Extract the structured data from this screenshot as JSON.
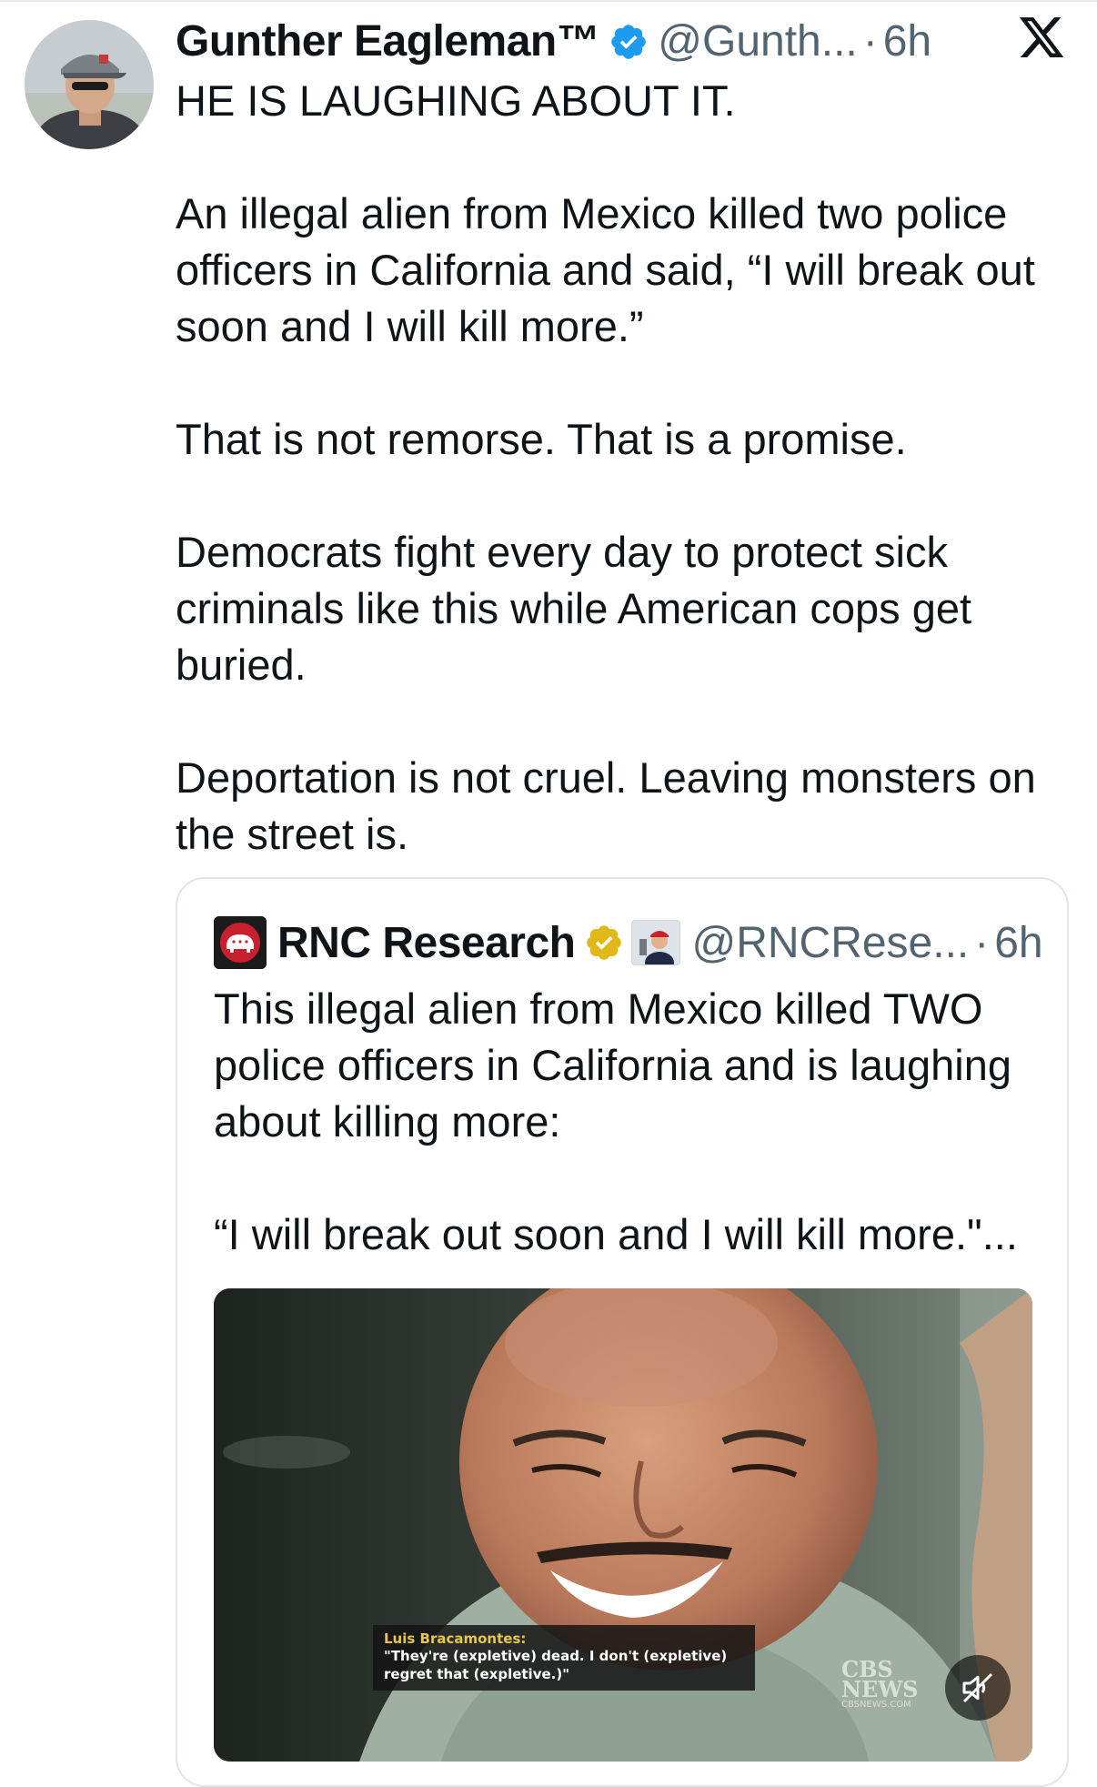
{
  "tweet": {
    "author_name": "Gunther Eagleman™",
    "handle": "@Gunth...",
    "separator": "·",
    "time": "6h",
    "paragraphs": [
      "HE IS LAUGHING ABOUT IT.",
      "An illegal alien from Mexico killed two police officers in California and said, “I will break out soon and I will kill more.”",
      "That is not remorse. That is a promise.",
      "Democrats fight every day to protect sick criminals like this while American cops get buried.",
      "Deportation is not cruel. Leaving monsters on the street is."
    ]
  },
  "quote": {
    "author_name": "RNC Research",
    "handle": "@RNCRese...",
    "separator": "·",
    "time": "6h",
    "paragraphs": [
      "This illegal alien from Mexico killed TWO police officers in California and is laughing about killing more:",
      "“I will break out soon and I will kill more.\"..."
    ],
    "media": {
      "caption_name": "Luis Bracamontes:",
      "caption_line1": "\"They're (expletive) dead. I don't (expletive)",
      "caption_line2": "regret that (expletive.)\"",
      "watermark_line1": "CBS",
      "watermark_line2": "NEWS",
      "watermark_url": "CBSNEWS.COM"
    }
  },
  "icons": {
    "verified": "verified-badge-icon",
    "gold": "gold-verified-badge-icon",
    "x_logo": "x-logo-icon",
    "mute": "muted-speaker-icon"
  },
  "colors": {
    "text": "#0f1419",
    "secondary": "#536471",
    "verified_blue": "#1d9bf0",
    "gold": "#e2b719",
    "border": "#e1e5e8"
  }
}
